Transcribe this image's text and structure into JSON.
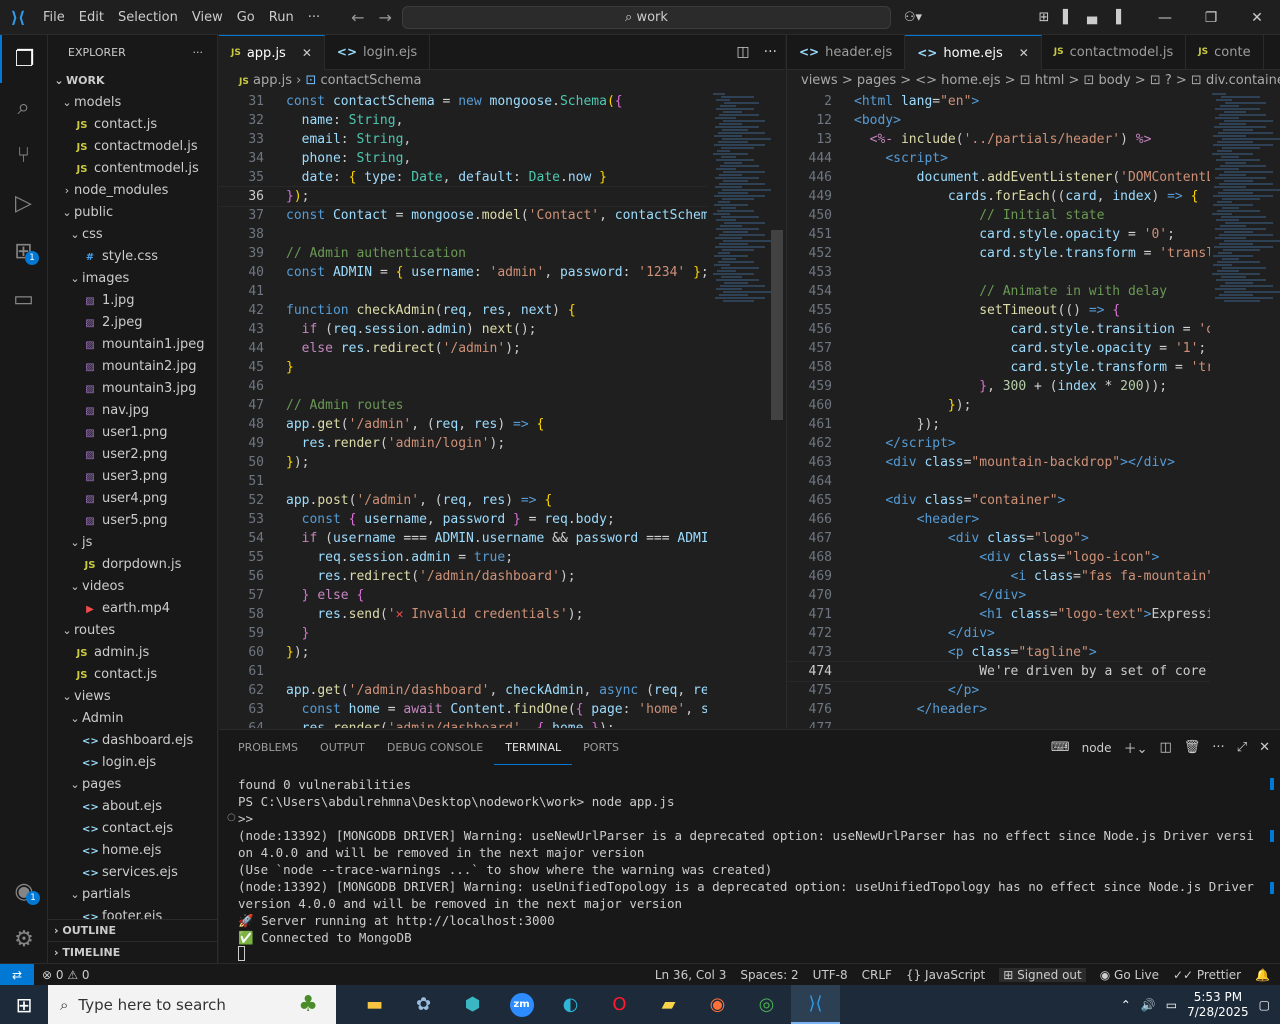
{
  "titlebar": {
    "menu": [
      "File",
      "Edit",
      "Selection",
      "View",
      "Go",
      "Run",
      "···"
    ],
    "search": "work"
  },
  "activity": {
    "extensions_badge": "1",
    "accounts_badge": "1"
  },
  "sidebar": {
    "title": "EXPLORER",
    "root": "WORK",
    "tree": [
      {
        "d": 1,
        "type": "folder",
        "label": "models",
        "open": true
      },
      {
        "d": 2,
        "type": "js",
        "label": "contact.js"
      },
      {
        "d": 2,
        "type": "js",
        "label": "contactmodel.js"
      },
      {
        "d": 2,
        "type": "js",
        "label": "contentmodel.js"
      },
      {
        "d": 1,
        "type": "folder",
        "label": "node_modules",
        "open": false
      },
      {
        "d": 1,
        "type": "folder",
        "label": "public",
        "open": true
      },
      {
        "d": 2,
        "type": "folder",
        "label": "css",
        "open": true
      },
      {
        "d": 3,
        "type": "css",
        "label": "style.css"
      },
      {
        "d": 2,
        "type": "folder",
        "label": "images",
        "open": true
      },
      {
        "d": 3,
        "type": "img",
        "label": "1.jpg"
      },
      {
        "d": 3,
        "type": "img",
        "label": "2.jpeg"
      },
      {
        "d": 3,
        "type": "img",
        "label": "mountain1.jpeg"
      },
      {
        "d": 3,
        "type": "img",
        "label": "mountain2.jpg"
      },
      {
        "d": 3,
        "type": "img",
        "label": "mountain3.jpg"
      },
      {
        "d": 3,
        "type": "img",
        "label": "nav.jpg"
      },
      {
        "d": 3,
        "type": "img",
        "label": "user1.png"
      },
      {
        "d": 3,
        "type": "img",
        "label": "user2.png"
      },
      {
        "d": 3,
        "type": "img",
        "label": "user3.png"
      },
      {
        "d": 3,
        "type": "img",
        "label": "user4.png"
      },
      {
        "d": 3,
        "type": "img",
        "label": "user5.png"
      },
      {
        "d": 2,
        "type": "folder",
        "label": "js",
        "open": true
      },
      {
        "d": 3,
        "type": "js",
        "label": "dorpdown.js"
      },
      {
        "d": 2,
        "type": "folder",
        "label": "videos",
        "open": true
      },
      {
        "d": 3,
        "type": "video",
        "label": "earth.mp4"
      },
      {
        "d": 1,
        "type": "folder",
        "label": "routes",
        "open": true
      },
      {
        "d": 2,
        "type": "js",
        "label": "admin.js"
      },
      {
        "d": 2,
        "type": "js",
        "label": "contact.js"
      },
      {
        "d": 1,
        "type": "folder",
        "label": "views",
        "open": true
      },
      {
        "d": 2,
        "type": "folder",
        "label": "Admin",
        "open": true
      },
      {
        "d": 3,
        "type": "ejs",
        "label": "dashboard.ejs"
      },
      {
        "d": 3,
        "type": "ejs",
        "label": "login.ejs"
      },
      {
        "d": 2,
        "type": "folder",
        "label": "pages",
        "open": true
      },
      {
        "d": 3,
        "type": "ejs",
        "label": "about.ejs"
      },
      {
        "d": 3,
        "type": "ejs",
        "label": "contact.ejs"
      },
      {
        "d": 3,
        "type": "ejs",
        "label": "home.ejs"
      },
      {
        "d": 3,
        "type": "ejs",
        "label": "services.ejs"
      },
      {
        "d": 2,
        "type": "folder",
        "label": "partials",
        "open": true
      },
      {
        "d": 3,
        "type": "ejs",
        "label": "footer.ejs"
      }
    ],
    "outline": "OUTLINE",
    "timeline": "TIMELINE"
  },
  "editor1": {
    "tabs": [
      {
        "label": "app.js",
        "icon": "JS",
        "active": true
      },
      {
        "label": "login.ejs",
        "icon": "<>",
        "active": false
      }
    ],
    "breadcrumb": [
      "app.js",
      "contactSchema"
    ],
    "lines": [
      {
        "n": "31",
        "h": "<span class='kw'>const</span> <span class='var'>contactSchema</span> <span class='pun'>=</span> <span class='kw'>new</span> <span class='var'>mongoose</span>.<span class='cls'>Schema</span><span class='br'>(</span><span class='br2'>{</span>"
      },
      {
        "n": "32",
        "h": "  <span class='var'>name</span>: <span class='cls'>String</span>,"
      },
      {
        "n": "33",
        "h": "  <span class='var'>email</span>: <span class='cls'>String</span>,"
      },
      {
        "n": "34",
        "h": "  <span class='var'>phone</span>: <span class='cls'>String</span>,"
      },
      {
        "n": "35",
        "h": "  <span class='var'>date</span>: <span class='br'>{</span> <span class='var'>type</span>: <span class='cls'>Date</span>, <span class='var'>default</span>: <span class='cls'>Date</span>.<span class='var'>now</span> <span class='br'>}</span>"
      },
      {
        "n": "36",
        "h": "<span class='br2'>}</span><span class='br'>)</span>;",
        "cur": true
      },
      {
        "n": "37",
        "h": "<span class='kw'>const</span> <span class='var'>Contact</span> <span class='pun'>=</span> <span class='var'>mongoose</span>.<span class='fn'>model</span>(<span class='str'>'Contact'</span>, <span class='var'>contactSchema</span>"
      },
      {
        "n": "38",
        "h": ""
      },
      {
        "n": "39",
        "h": "<span class='cm'>// Admin authentication</span>"
      },
      {
        "n": "40",
        "h": "<span class='kw'>const</span> <span class='var'>ADMIN</span> <span class='pun'>=</span> <span class='br'>{</span> <span class='var'>username</span>: <span class='str'>'admin'</span>, <span class='var'>password</span>: <span class='str'>'1234'</span> <span class='br'>}</span>;"
      },
      {
        "n": "41",
        "h": ""
      },
      {
        "n": "42",
        "h": "<span class='kw'>function</span> <span class='fn'>checkAdmin</span>(<span class='var'>req</span>, <span class='var'>res</span>, <span class='var'>next</span>) <span class='br'>{</span>"
      },
      {
        "n": "43",
        "h": "  <span class='kw2'>if</span> (<span class='var'>req</span>.<span class='var'>session</span>.<span class='var'>admin</span>) <span class='fn'>next</span>();"
      },
      {
        "n": "44",
        "h": "  <span class='kw2'>else</span> <span class='var'>res</span>.<span class='fn'>redirect</span>(<span class='str'>'/admin'</span>);"
      },
      {
        "n": "45",
        "h": "<span class='br'>}</span>"
      },
      {
        "n": "46",
        "h": ""
      },
      {
        "n": "47",
        "h": "<span class='cm'>// Admin routes</span>"
      },
      {
        "n": "48",
        "h": "<span class='var'>app</span>.<span class='fn'>get</span>(<span class='str'>'/admin'</span>, (<span class='var'>req</span>, <span class='var'>res</span>) <span class='kw'>=&gt;</span> <span class='br'>{</span>"
      },
      {
        "n": "49",
        "h": "  <span class='var'>res</span>.<span class='fn'>render</span>(<span class='str'>'admin/login'</span>);"
      },
      {
        "n": "50",
        "h": "<span class='br'>}</span>);"
      },
      {
        "n": "51",
        "h": ""
      },
      {
        "n": "52",
        "h": "<span class='var'>app</span>.<span class='fn'>post</span>(<span class='str'>'/admin'</span>, (<span class='var'>req</span>, <span class='var'>res</span>) <span class='kw'>=&gt;</span> <span class='br'>{</span>"
      },
      {
        "n": "53",
        "h": "  <span class='kw'>const</span> <span class='br2'>{</span> <span class='var'>username</span>, <span class='var'>password</span> <span class='br2'>}</span> <span class='pun'>=</span> <span class='var'>req</span>.<span class='var'>body</span>;"
      },
      {
        "n": "54",
        "h": "  <span class='kw2'>if</span> (<span class='var'>username</span> <span class='pun'>===</span> <span class='var'>ADMIN</span>.<span class='var'>username</span> <span class='pun'>&amp;&amp;</span> <span class='var'>password</span> <span class='pun'>===</span> <span class='var'>ADMIN</span>"
      },
      {
        "n": "55",
        "h": "    <span class='var'>req</span>.<span class='var'>session</span>.<span class='var'>admin</span> <span class='pun'>=</span> <span class='kw'>true</span>;"
      },
      {
        "n": "56",
        "h": "    <span class='var'>res</span>.<span class='fn'>redirect</span>(<span class='str'>'/admin/dashboard'</span>);"
      },
      {
        "n": "57",
        "h": "  <span class='br2'>}</span> <span class='kw2'>else</span> <span class='br2'>{</span>"
      },
      {
        "n": "58",
        "h": "    <span class='var'>res</span>.<span class='fn'>send</span>(<span class='str'>'<span style=\"color:#f14c4c\">✕</span> Invalid credentials'</span>);"
      },
      {
        "n": "59",
        "h": "  <span class='br2'>}</span>"
      },
      {
        "n": "60",
        "h": "<span class='br'>}</span>);"
      },
      {
        "n": "61",
        "h": ""
      },
      {
        "n": "62",
        "h": "<span class='var'>app</span>.<span class='fn'>get</span>(<span class='str'>'/admin/dashboard'</span>, <span class='var'>checkAdmin</span>, <span class='kw'>async</span> (<span class='var'>req</span>, <span class='var'>res</span>"
      },
      {
        "n": "63",
        "h": "  <span class='kw'>const</span> <span class='var'>home</span> <span class='pun'>=</span> <span class='kw2'>await</span> <span class='var'>Content</span>.<span class='fn'>findOne</span>(<span class='br2'>{</span> <span class='var'>page</span>: <span class='str'>'home'</span>, <span class='var'>se</span>"
      },
      {
        "n": "64",
        "h": "  <span class='var'>res</span>.<span class='fn'>render</span>(<span class='str'>'admin/dashboard'</span>, <span class='br2'>{</span> <span class='var'>home</span> <span class='br2'>}</span>);"
      }
    ]
  },
  "editor2": {
    "tabs": [
      {
        "label": "header.ejs",
        "icon": "<>",
        "active": false
      },
      {
        "label": "home.ejs",
        "icon": "<>",
        "active": true
      },
      {
        "label": "contactmodel.js",
        "icon": "JS",
        "active": false
      },
      {
        "label": "conte",
        "icon": "JS",
        "active": false
      }
    ],
    "breadcrumb": "views > pages > <> home.ejs > ⊡ html > ⊡ body > ⊡ ? > ⊡ div.container > ⊡",
    "lines": [
      {
        "n": "2",
        "h": "<span class='tag'>&lt;html</span> <span class='attr'>lang</span>=<span class='str'>\"en\"</span><span class='tag'>&gt;</span>"
      },
      {
        "n": "12",
        "h": "<span class='tag'>&lt;body&gt;</span>"
      },
      {
        "n": "13",
        "h": "  <span class='kw2'>&lt;%-</span> <span class='fn'>include</span>(<span class='str'>'../partials/header'</span>) <span class='kw2'>%&gt;</span>"
      },
      {
        "n": "444",
        "h": "    <span class='tag'>&lt;script&gt;</span>"
      },
      {
        "n": "446",
        "h": "        <span class='var'>document</span>.<span class='fn'>addEventListener</span>(<span class='str'>'DOMContentLo</span>"
      },
      {
        "n": "449",
        "h": "            <span class='var'>cards</span>.<span class='fn'>forEach</span>((<span class='var'>card</span>, <span class='var'>index</span>) <span class='kw'>=&gt;</span> <span class='br'>{</span>"
      },
      {
        "n": "450",
        "h": "                <span class='cm'>// Initial state</span>"
      },
      {
        "n": "451",
        "h": "                <span class='var'>card</span>.<span class='var'>style</span>.<span class='var'>opacity</span> <span class='pun'>=</span> <span class='str'>'0'</span>;"
      },
      {
        "n": "452",
        "h": "                <span class='var'>card</span>.<span class='var'>style</span>.<span class='var'>transform</span> <span class='pun'>=</span> <span class='str'>'transla</span>"
      },
      {
        "n": "453",
        "h": ""
      },
      {
        "n": "454",
        "h": "                <span class='cm'>// Animate in with delay</span>"
      },
      {
        "n": "455",
        "h": "                <span class='fn'>setTimeout</span>(() <span class='kw'>=&gt;</span> <span class='br2'>{</span>"
      },
      {
        "n": "456",
        "h": "                    <span class='var'>card</span>.<span class='var'>style</span>.<span class='var'>transition</span> <span class='pun'>=</span> <span class='str'>'op</span>"
      },
      {
        "n": "457",
        "h": "                    <span class='var'>card</span>.<span class='var'>style</span>.<span class='var'>opacity</span> <span class='pun'>=</span> <span class='str'>'1'</span>;"
      },
      {
        "n": "458",
        "h": "                    <span class='var'>card</span>.<span class='var'>style</span>.<span class='var'>transform</span> <span class='pun'>=</span> <span class='str'>'tra</span>"
      },
      {
        "n": "459",
        "h": "                <span class='br2'>}</span>, <span class='num-c'>300</span> <span class='pun'>+</span> (<span class='var'>index</span> <span class='pun'>*</span> <span class='num-c'>200</span>));"
      },
      {
        "n": "460",
        "h": "            <span class='br'>}</span>);"
      },
      {
        "n": "461",
        "h": "        });"
      },
      {
        "n": "462",
        "h": "    <span class='tag'>&lt;/script&gt;</span>"
      },
      {
        "n": "463",
        "h": "    <span class='tag'>&lt;div</span> <span class='attr'>class</span>=<span class='str'>\"mountain-backdrop\"</span><span class='tag'>&gt;&lt;/div&gt;</span>"
      },
      {
        "n": "464",
        "h": ""
      },
      {
        "n": "465",
        "h": "    <span class='tag'>&lt;div</span> <span class='attr'>class</span>=<span class='str'>\"container\"</span><span class='tag'>&gt;</span>"
      },
      {
        "n": "466",
        "h": "        <span class='tag'>&lt;header&gt;</span>"
      },
      {
        "n": "467",
        "h": "            <span class='tag'>&lt;div</span> <span class='attr'>class</span>=<span class='str'>\"logo\"</span><span class='tag'>&gt;</span>"
      },
      {
        "n": "468",
        "h": "                <span class='tag'>&lt;div</span> <span class='attr'>class</span>=<span class='str'>\"logo-icon\"</span><span class='tag'>&gt;</span>"
      },
      {
        "n": "469",
        "h": "                    <span class='tag'>&lt;i</span> <span class='attr'>class</span>=<span class='str'>\"fas fa-mountain\"</span>"
      },
      {
        "n": "470",
        "h": "                <span class='tag'>&lt;/div&gt;</span>"
      },
      {
        "n": "471",
        "h": "                <span class='tag'>&lt;h1</span> <span class='attr'>class</span>=<span class='str'>\"logo-text\"</span><span class='tag'>&gt;</span>Expressio"
      },
      {
        "n": "472",
        "h": "            <span class='tag'>&lt;/div&gt;</span>"
      },
      {
        "n": "473",
        "h": "            <span class='tag'>&lt;p</span> <span class='attr'>class</span>=<span class='str'>\"tagline\"</span><span class='tag'>&gt;</span>"
      },
      {
        "n": "474",
        "h": "                We're driven by a set of core v",
        "cur": true
      },
      {
        "n": "475",
        "h": "            <span class='tag'>&lt;/p&gt;</span>"
      },
      {
        "n": "476",
        "h": "        <span class='tag'>&lt;/header&gt;</span>"
      },
      {
        "n": "477",
        "h": ""
      }
    ]
  },
  "panel": {
    "tabs": [
      "PROBLEMS",
      "OUTPUT",
      "DEBUG CONSOLE",
      "TERMINAL",
      "PORTS"
    ],
    "active_tab": "TERMINAL",
    "terminal_name": "node",
    "terminal_lines": [
      "found 0 vulnerabilities",
      "PS C:\\Users\\abdulrehmna\\Desktop\\nodework\\work> node app.js",
      ">>",
      "(node:13392) [MONGODB DRIVER] Warning: useNewUrlParser is a deprecated option: useNewUrlParser has no effect since Node.js Driver version 4.0.0 and will be removed in the next major version",
      "(Use `node --trace-warnings ...` to show where the warning was created)",
      "(node:13392) [MONGODB DRIVER] Warning: useUnifiedTopology is a deprecated option: useUnifiedTopology has no effect since Node.js Driver version 4.0.0 and will be removed in the next major version",
      "🚀 Server running at http://localhost:3000",
      "✅ Connected to MongoDB"
    ]
  },
  "statusbar": {
    "problems": "⊗ 0 ⚠ 0",
    "position": "Ln 36, Col 3",
    "spaces": "Spaces: 2",
    "encoding": "UTF-8",
    "eol": "CRLF",
    "language": "{} JavaScript",
    "account": "Signed out",
    "golive": "Go Live",
    "prettier": "✓✓ Prettier"
  },
  "taskbar": {
    "search_placeholder": "Type here to search",
    "time": "5:53 PM",
    "date": "7/28/2025"
  }
}
